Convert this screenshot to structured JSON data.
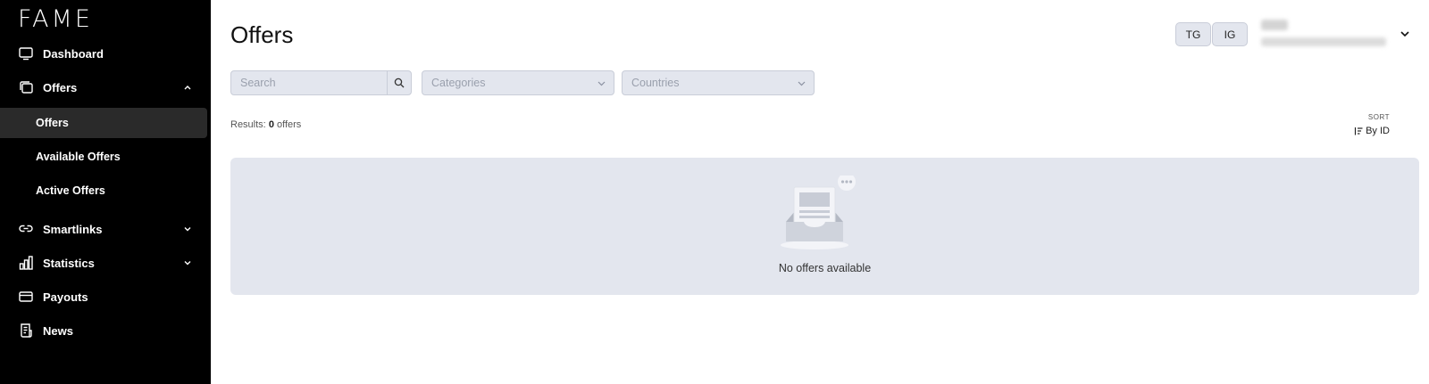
{
  "app": {
    "logo": "FAME"
  },
  "sidebar": {
    "items": [
      {
        "label": "Dashboard",
        "icon": "monitor-icon"
      },
      {
        "label": "Offers",
        "icon": "layers-icon",
        "expanded": true
      },
      {
        "label": "Smartlinks",
        "icon": "link-icon",
        "expanded": false
      },
      {
        "label": "Statistics",
        "icon": "bar-chart-icon",
        "expanded": false
      },
      {
        "label": "Payouts",
        "icon": "card-icon"
      },
      {
        "label": "News",
        "icon": "newspaper-icon"
      }
    ],
    "offers_sub": [
      {
        "label": "Offers",
        "active": true
      },
      {
        "label": "Available Offers"
      },
      {
        "label": "Active Offers"
      }
    ]
  },
  "header": {
    "title": "Offers",
    "pills": [
      "TG",
      "IG"
    ]
  },
  "filters": {
    "search_placeholder": "Search",
    "categories_placeholder": "Categories",
    "countries_placeholder": "Countries"
  },
  "results": {
    "prefix": "Results:",
    "count": "0",
    "suffix": "offers"
  },
  "sort": {
    "label": "SORT",
    "value": "By ID"
  },
  "empty": {
    "message": "No offers available"
  },
  "colors": {
    "sidebar_bg": "#000000",
    "active_item_bg": "#2a2a2a",
    "panel_bg": "#e3e6ee",
    "border": "#c9cdd8"
  }
}
